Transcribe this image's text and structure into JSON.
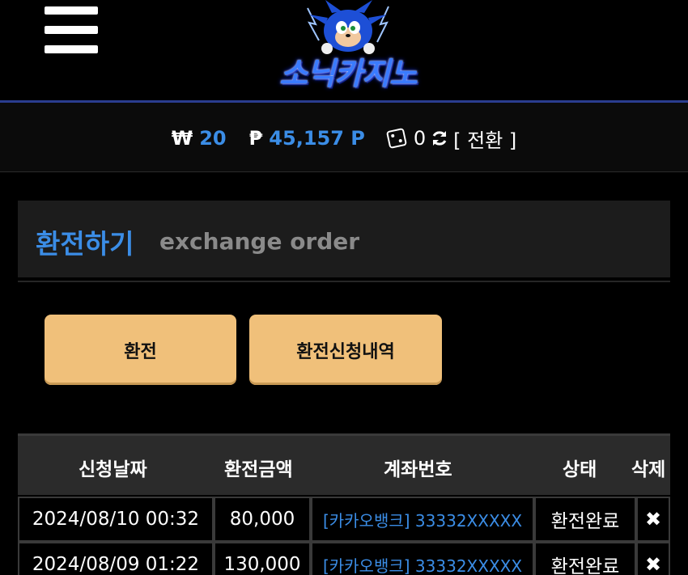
{
  "logo": {
    "text": "소닉카지노"
  },
  "balance": {
    "won_symbol": "₩",
    "won_value": "20",
    "point_symbol": "₱",
    "point_value": "45,157 P",
    "chip_value": "0",
    "convert_label": "[ 전환 ]"
  },
  "section": {
    "title_ko": "환전하기",
    "title_en": "exchange order"
  },
  "buttons": {
    "exchange": "환전",
    "history": "환전신청내역"
  },
  "table": {
    "headers": [
      "신청날짜",
      "환전금액",
      "계좌번호",
      "상태",
      "삭제"
    ],
    "rows": [
      {
        "date": "2024/08/10 00:32",
        "amount": "80,000",
        "account": "[카카오뱅크] 33332XXXXX",
        "status": "환전완료",
        "delete": "✖"
      },
      {
        "date": "2024/08/09 01:22",
        "amount": "130,000",
        "account": "[카카오뱅크] 33332XXXXX",
        "status": "환전완료",
        "delete": "✖"
      }
    ]
  },
  "colors": {
    "accent": "#3b8de6",
    "button": "#f0c07a",
    "header_line": "#2a3d8f"
  }
}
